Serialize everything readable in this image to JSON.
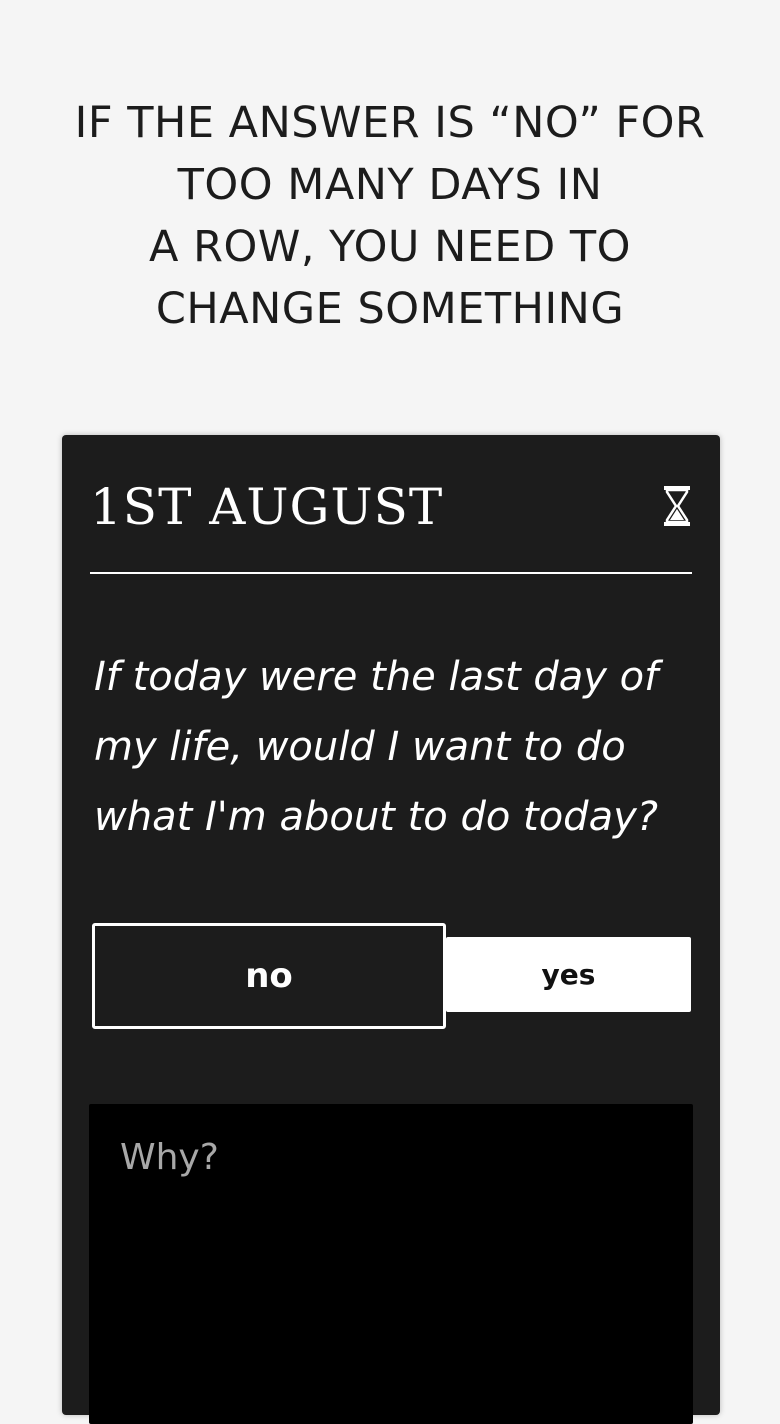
{
  "headline": {
    "lines": [
      "IF THE ANSWER IS “NO” FOR",
      "TOO MANY DAYS IN",
      "A ROW, YOU NEED TO",
      "CHANGE SOMETHING"
    ]
  },
  "card": {
    "date": "1ST AUGUST",
    "timer_icon": "hourglass-icon",
    "question_lines": [
      "If today were the last day of",
      "my life, would I want to do",
      "what I'm about to do today?"
    ],
    "no_label": "no",
    "yes_label": "yes",
    "why_placeholder": "Why?"
  },
  "colors": {
    "background": "#f5f5f5",
    "card": "#1c1c1c",
    "input": "#000000",
    "text_light": "#ffffff",
    "text_dark": "#1c1c1c",
    "placeholder": "#a8a8a8"
  }
}
